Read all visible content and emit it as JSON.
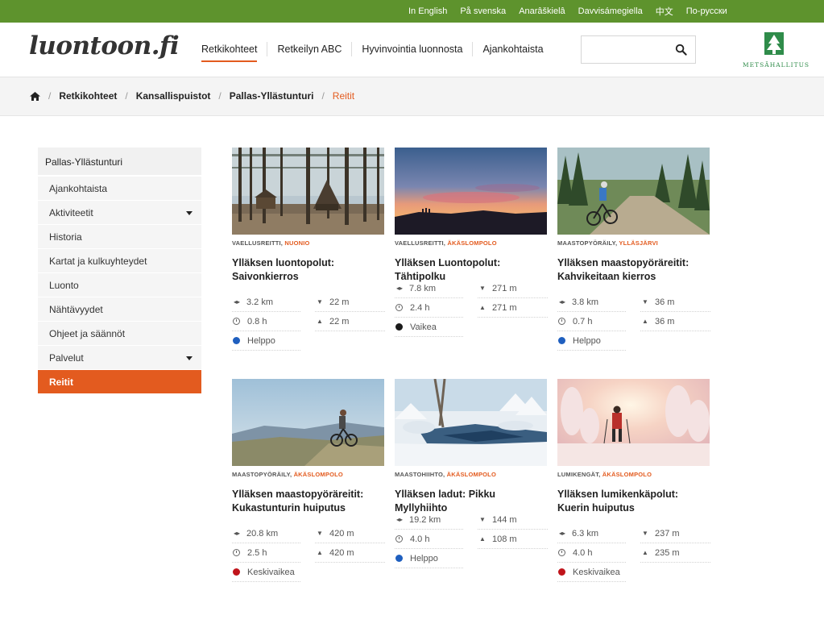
{
  "languages": [
    "In English",
    "På svenska",
    "Anarâškielâ",
    "Davvisámegiella",
    "中文",
    "По-русски"
  ],
  "header": {
    "logo": "luontoon.fi",
    "nav": [
      "Retkikohteet",
      "Retkeilyn ABC",
      "Hyvinvointia luonnosta",
      "Ajankohtaista"
    ],
    "active_nav": "Retkikohteet",
    "search": {
      "value": "",
      "placeholder": ""
    },
    "partner_logo": "METSÄHALLITUS"
  },
  "breadcrumb": {
    "items": [
      "Retkikohteet",
      "Kansallispuistot",
      "Pallas-Yllästunturi"
    ],
    "current": "Reitit"
  },
  "sidebar": {
    "title": "Pallas-Yllästunturi",
    "items": [
      {
        "label": "Ajankohtaista",
        "has_submenu": false
      },
      {
        "label": "Aktiviteetit",
        "has_submenu": true
      },
      {
        "label": "Historia",
        "has_submenu": false
      },
      {
        "label": "Kartat ja kulkuyhteydet",
        "has_submenu": false
      },
      {
        "label": "Luonto",
        "has_submenu": false
      },
      {
        "label": "Nähtävyydet",
        "has_submenu": false
      },
      {
        "label": "Ohjeet ja säännöt",
        "has_submenu": false
      },
      {
        "label": "Palvelut",
        "has_submenu": true
      },
      {
        "label": "Reitit",
        "has_submenu": false,
        "active": true
      }
    ]
  },
  "colors": {
    "accent": "#e35b1f",
    "topbar": "#5e932d",
    "easy": "#1f5fbf",
    "hard": "#1a1a1a",
    "medium": "#c0141b"
  },
  "routes": [
    {
      "category": "VAELLUSREITTI",
      "place": "NUONIO",
      "title": "Ylläksen luontopolut: Saivonkierros",
      "distance": "3.2 km",
      "duration": "0.8 h",
      "descent": "22 m",
      "ascent": "22 m",
      "difficulty": "Helppo",
      "difficulty_color": "#1f5fbf",
      "image": "forest-lean-to-photo"
    },
    {
      "category": "VAELLUSREITTI",
      "place": "ÄKÄSLOMPOLO",
      "title": "Ylläksen Luontopolut: Tähtipolku",
      "distance": "7.8 km",
      "duration": "2.4 h",
      "descent": "271 m",
      "ascent": "271 m",
      "difficulty": "Vaikea",
      "difficulty_color": "#1a1a1a",
      "image": "fell-sunset-photo"
    },
    {
      "category": "MAASTOPYÖRÄILY",
      "place": "YLLÄSJÄRVI",
      "title": "Ylläksen maastopyöräreitit: Kahvikeitaan kierros",
      "distance": "3.8 km",
      "duration": "0.7 h",
      "descent": "36 m",
      "ascent": "36 m",
      "difficulty": "Helppo",
      "difficulty_color": "#1f5fbf",
      "image": "forest-cyclist-photo"
    },
    {
      "category": "MAASTOPYÖRÄILY",
      "place": "ÄKÄSLOMPOLO",
      "title": "Ylläksen maastopyöräreitit: Kukastunturin huiputus",
      "distance": "20.8 km",
      "duration": "2.5 h",
      "descent": "420 m",
      "ascent": "420 m",
      "difficulty": "Keskivaikea",
      "difficulty_color": "#c0141b",
      "image": "fell-top-cyclist-photo"
    },
    {
      "category": "MAASTOHIIHTO",
      "place": "ÄKÄSLOMPOLO",
      "title": "Ylläksen ladut: Pikku Myllyhiihto",
      "distance": "19.2 km",
      "duration": "4.0 h",
      "descent": "144 m",
      "ascent": "108 m",
      "difficulty": "Helppo",
      "difficulty_color": "#1f5fbf",
      "image": "winter-river-photo"
    },
    {
      "category": "LUMIKENGÄT",
      "place": "ÄKÄSLOMPOLO",
      "title": "Ylläksen lumikenkäpolut: Kuerin huiputus",
      "distance": "6.3 km",
      "duration": "4.0 h",
      "descent": "237 m",
      "ascent": "235 m",
      "difficulty": "Keskivaikea",
      "difficulty_color": "#c0141b",
      "image": "snowshoe-hiker-photo"
    }
  ]
}
